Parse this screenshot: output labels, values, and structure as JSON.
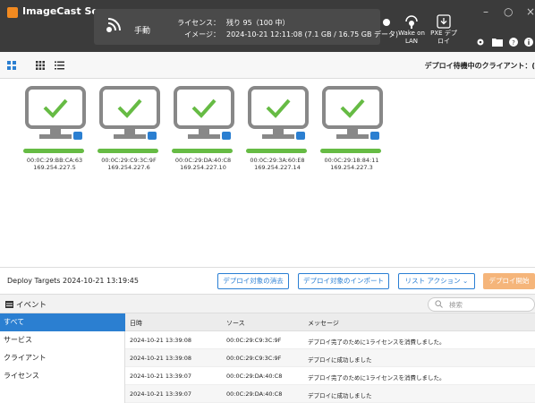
{
  "app": {
    "title": "ImageCast Server"
  },
  "header": {
    "mode_label": "手動",
    "license_key": "ライセンス：",
    "license_value": "残り 95（100 中）",
    "image_key": "イメージ：",
    "image_value": "2024-10-21 12:11:08 (7.1 GB / 16.75 GB データ)"
  },
  "toolbar": {
    "wol_label_1": "Wake on",
    "wol_label_2": "LAN",
    "pxe_label_1": "PXE デプ",
    "pxe_label_2": "ロイ"
  },
  "window_controls": {
    "minimize": "–",
    "maximize": "○",
    "close": "×"
  },
  "viewbar": {
    "pending_label": "デプロイ待機中のクライアント：("
  },
  "targets": [
    {
      "mac": "00:0C:29:BB:CA:63",
      "ip": "169.254.227.5",
      "progress": 1.0
    },
    {
      "mac": "00:0C:29:C9:3C:9F",
      "ip": "169.254.227.6",
      "progress": 1.0
    },
    {
      "mac": "00:0C:29:DA:40:C8",
      "ip": "169.254.227.10",
      "progress": 1.0
    },
    {
      "mac": "00:0C:29:3A:60:E8",
      "ip": "169.254.227.14",
      "progress": 1.0
    },
    {
      "mac": "00:0C:29:18:84:11",
      "ip": "169.254.227.3",
      "progress": 1.0
    }
  ],
  "deploy": {
    "title": "Deploy Targets 2024-10-21 13:19:45",
    "clear_label": "デプロイ対象の消去",
    "import_label": "デプロイ対象のインポート",
    "list_action_label": "リスト アクション ⌄",
    "start_label": "デプロイ開始"
  },
  "events": {
    "title": "イベント",
    "search_placeholder": "検索",
    "filters": [
      "すべて",
      "サービス",
      "クライアント",
      "ライセンス"
    ],
    "columns": {
      "time": "日時",
      "source": "ソース",
      "message": "メッセージ"
    },
    "rows": [
      {
        "time": "2024-10-21 13:39:08",
        "source": "00:0C:29:C9:3C:9F",
        "message": "デプロイ完了のために1ライセンスを消費しました。"
      },
      {
        "time": "2024-10-21 13:39:08",
        "source": "00:0C:29:C9:3C:9F",
        "message": "デプロイに成功しました"
      },
      {
        "time": "2024-10-21 13:39:07",
        "source": "00:0C:29:DA:40:C8",
        "message": "デプロイ完了のために1ライセンスを消費しました。"
      },
      {
        "time": "2024-10-21 13:39:07",
        "source": "00:0C:29:DA:40:C8",
        "message": "デプロイに成功しました"
      }
    ]
  },
  "colors": {
    "accent": "#2b7fd1",
    "success": "#66bb44",
    "start_button": "#f5b57a",
    "titlebar": "#3b3b3b"
  }
}
